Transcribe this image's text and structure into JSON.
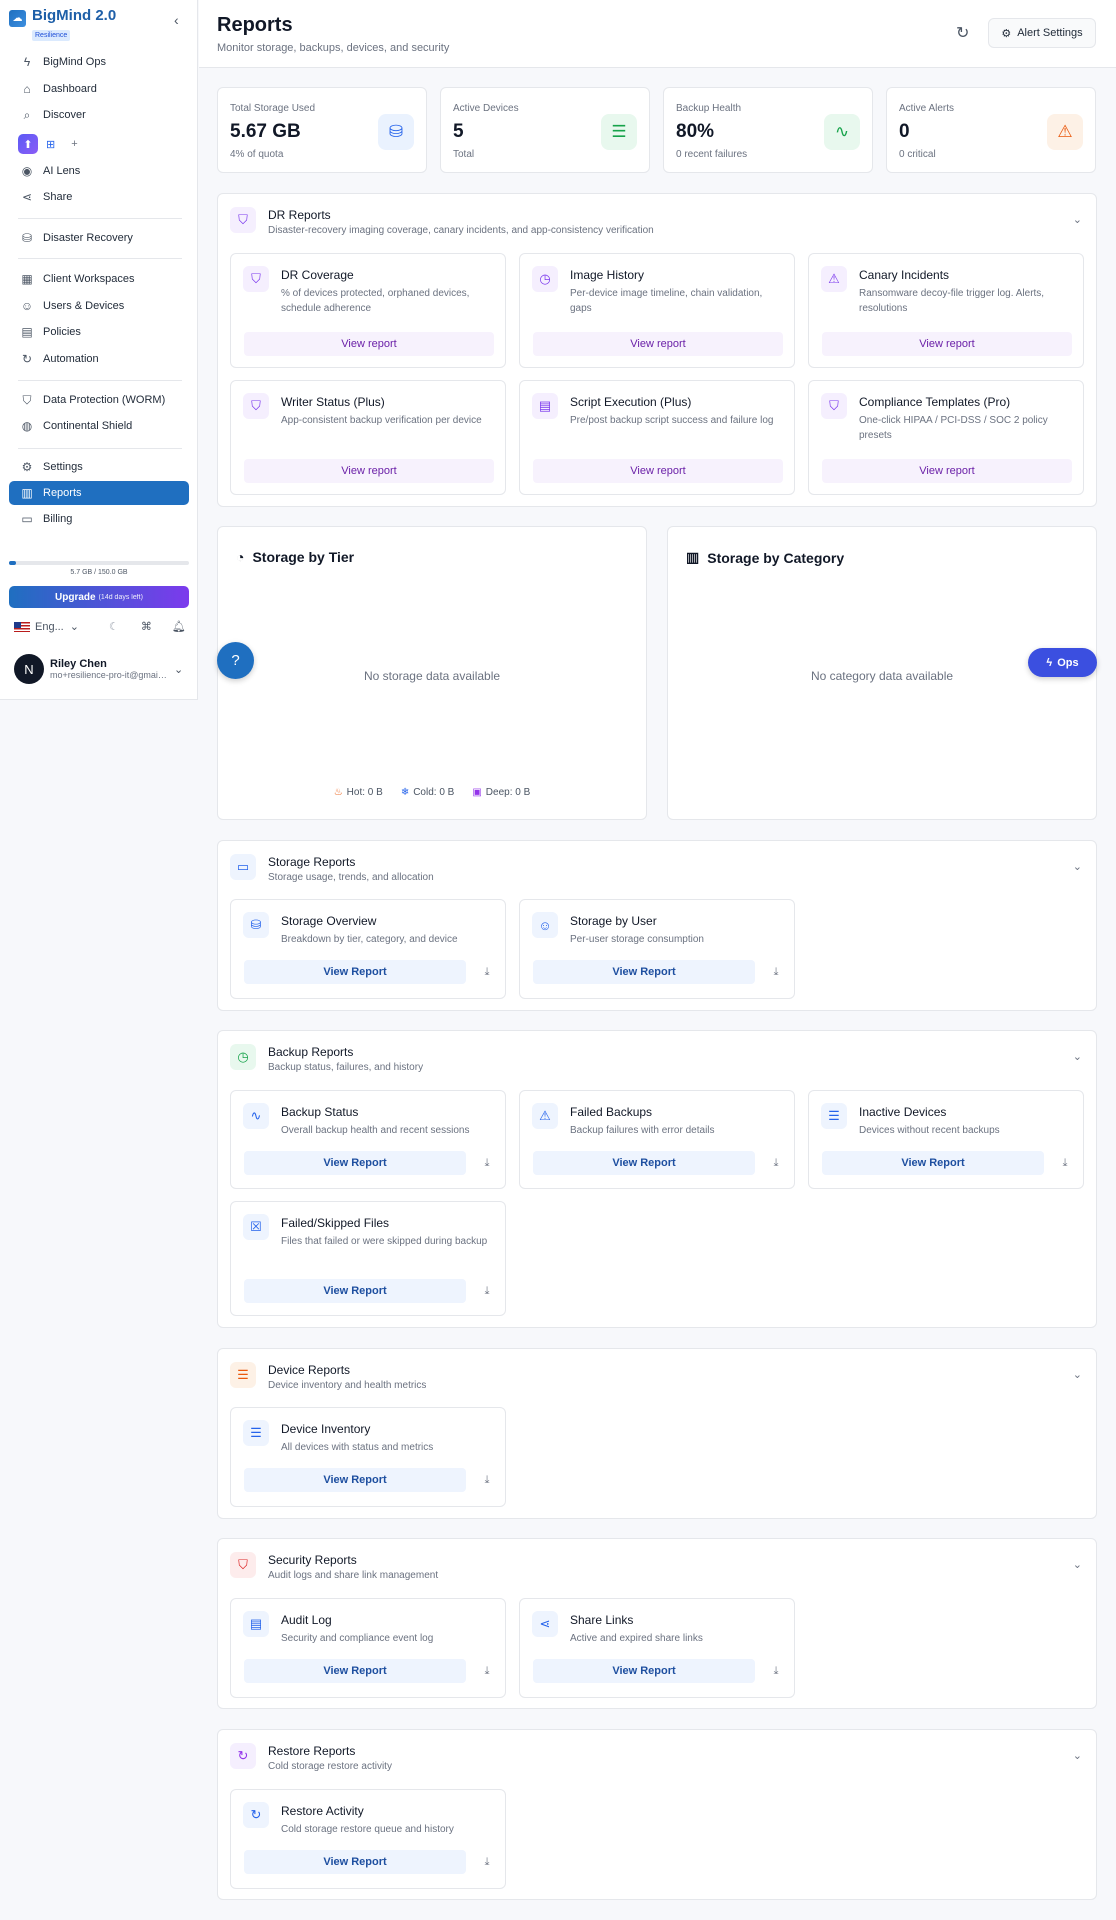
{
  "sidebar": {
    "brand": "BigMind 2.0",
    "badge": "Resilience",
    "items": [
      {
        "label": "BigMind Ops",
        "icon": "bolt-icon"
      },
      {
        "label": "Dashboard",
        "icon": "home-icon"
      },
      {
        "label": "Discover",
        "icon": "search-icon"
      },
      {
        "label": "AI Lens",
        "icon": "eye-icon"
      },
      {
        "label": "Share",
        "icon": "share-icon"
      },
      {
        "label": "Disaster Recovery",
        "icon": "database-icon"
      },
      {
        "label": "Client Workspaces",
        "icon": "building-icon"
      },
      {
        "label": "Users & Devices",
        "icon": "users-icon"
      },
      {
        "label": "Policies",
        "icon": "clipboard-icon"
      },
      {
        "label": "Automation",
        "icon": "refresh-icon"
      },
      {
        "label": "Data Protection (WORM)",
        "icon": "shield-check-icon"
      },
      {
        "label": "Continental Shield",
        "icon": "globe-icon"
      },
      {
        "label": "Settings",
        "icon": "gear-icon"
      },
      {
        "label": "Reports",
        "icon": "bar-chart-icon"
      },
      {
        "label": "Billing",
        "icon": "receipt-icon"
      }
    ],
    "os_add": "+",
    "quota_text": "5.7 GB / 150.0 GB",
    "quota_fraction": 0.038,
    "upgrade_label": "Upgrade",
    "upgrade_note": "(14d days left)",
    "language": "Eng...",
    "user_initial": "N",
    "user_name": "Riley Chen",
    "user_email": "mo+resilience-pro-it@gmail.com"
  },
  "header": {
    "title": "Reports",
    "subtitle": "Monitor storage, backups, devices, and security",
    "alert_settings": "Alert Settings"
  },
  "stats": [
    {
      "label": "Total Storage Used",
      "value": "5.67 GB",
      "sub": "4% of quota",
      "icon": "database-icon",
      "color": "#2563eb",
      "bg": "#eaf2fe"
    },
    {
      "label": "Active Devices",
      "value": "5",
      "sub": "Total",
      "icon": "server-icon",
      "color": "#16a34a",
      "bg": "#e8f8ee"
    },
    {
      "label": "Backup Health",
      "value": "80%",
      "sub": "0 recent failures",
      "icon": "activity-icon",
      "color": "#16a34a",
      "bg": "#e8f8ee"
    },
    {
      "label": "Active Alerts",
      "value": "0",
      "sub": "0 critical",
      "icon": "warning-icon",
      "color": "#ea580c",
      "bg": "#fdf1e6"
    }
  ],
  "dr": {
    "title": "DR Reports",
    "subtitle": "Disaster-recovery imaging coverage, canary incidents, and app-consistency verification",
    "button": "View report",
    "cards": [
      {
        "title": "DR Coverage",
        "desc": "% of devices protected, orphaned devices, schedule adherence",
        "icon": "shield-icon"
      },
      {
        "title": "Image History",
        "desc": "Per-device image timeline, chain validation, gaps",
        "icon": "clock-icon"
      },
      {
        "title": "Canary Incidents",
        "desc": "Ransomware decoy-file trigger log. Alerts, resolutions",
        "icon": "warning-icon"
      },
      {
        "title": "Writer Status (Plus)",
        "desc": "App-consistent backup verification per device",
        "icon": "shield-icon"
      },
      {
        "title": "Script Execution (Plus)",
        "desc": "Pre/post backup script success and failure log",
        "icon": "document-icon"
      },
      {
        "title": "Compliance Templates (Pro)",
        "desc": "One-click HIPAA / PCI-DSS / SOC 2 policy presets",
        "icon": "shield-icon"
      }
    ]
  },
  "charts": {
    "tier_title": "Storage by Tier",
    "tier_empty": "No storage data available",
    "tier_legend": [
      "Hot: 0 B",
      "Cold: 0 B",
      "Deep: 0 B"
    ],
    "category_title": "Storage by Category",
    "category_empty": "No category data available"
  },
  "button_label": "View Report",
  "sections": {
    "storage": {
      "title": "Storage Reports",
      "subtitle": "Storage usage, trends, and allocation",
      "cards": [
        {
          "title": "Storage Overview",
          "desc": "Breakdown by tier, category, and device",
          "icon": "database-icon"
        },
        {
          "title": "Storage by User",
          "desc": "Per-user storage consumption",
          "icon": "users-icon"
        }
      ]
    },
    "backup": {
      "title": "Backup Reports",
      "subtitle": "Backup status, failures, and history",
      "cards": [
        {
          "title": "Backup Status",
          "desc": "Overall backup health and recent sessions",
          "icon": "activity-icon"
        },
        {
          "title": "Failed Backups",
          "desc": "Backup failures with error details",
          "icon": "warning-icon"
        },
        {
          "title": "Inactive Devices",
          "desc": "Devices without recent backups",
          "icon": "server-icon"
        },
        {
          "title": "Failed/Skipped Files",
          "desc": "Files that failed or were skipped during backup",
          "icon": "file-x-icon"
        }
      ]
    },
    "device": {
      "title": "Device Reports",
      "subtitle": "Device inventory and health metrics",
      "cards": [
        {
          "title": "Device Inventory",
          "desc": "All devices with status and metrics",
          "icon": "server-icon"
        }
      ]
    },
    "security": {
      "title": "Security Reports",
      "subtitle": "Audit logs and share link management",
      "cards": [
        {
          "title": "Audit Log",
          "desc": "Security and compliance event log",
          "icon": "document-icon"
        },
        {
          "title": "Share Links",
          "desc": "Active and expired share links",
          "icon": "share-icon"
        }
      ]
    },
    "restore": {
      "title": "Restore Reports",
      "subtitle": "Cold storage restore activity",
      "cards": [
        {
          "title": "Restore Activity",
          "desc": "Cold storage restore queue and history",
          "icon": "refresh-icon"
        }
      ]
    }
  },
  "ops_label": "Ops",
  "colors": {
    "primary": "#1f6fc0",
    "dr_purple": "#7c3aed",
    "ops_blue": "#3b4fe0"
  }
}
